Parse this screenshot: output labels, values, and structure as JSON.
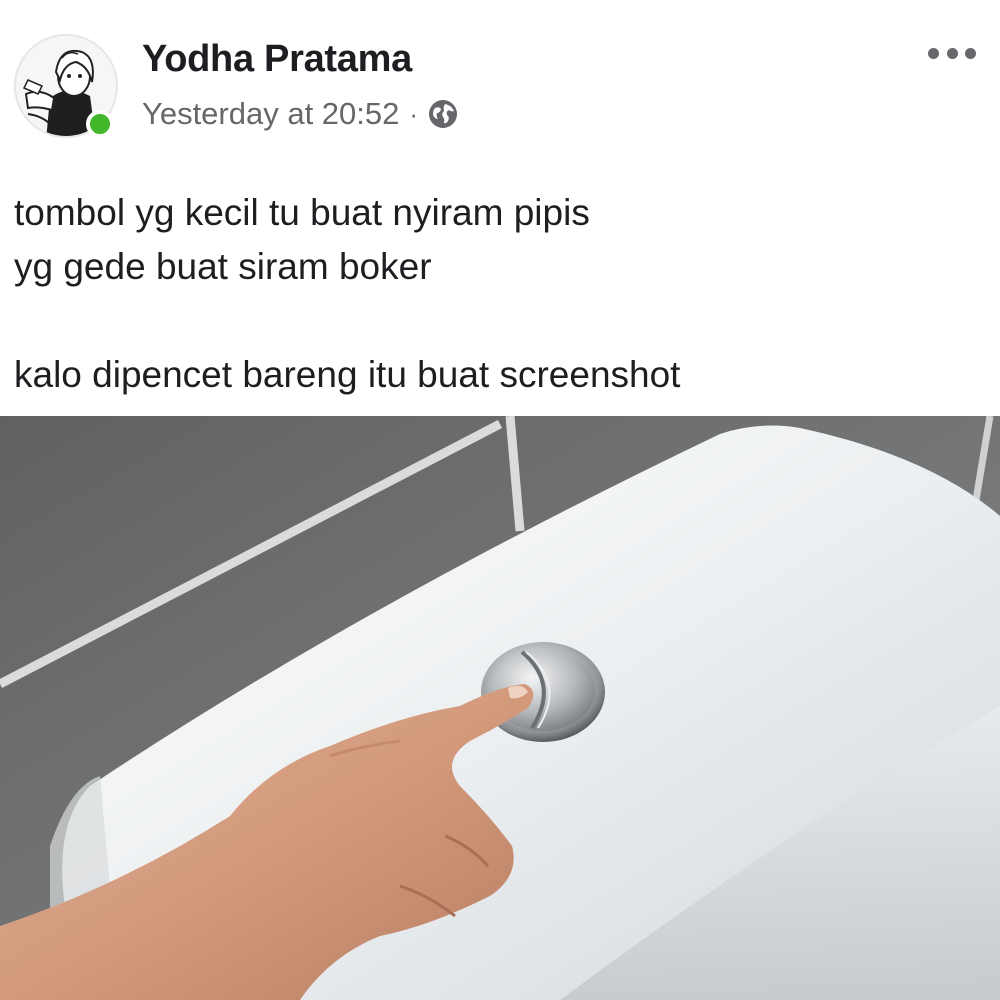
{
  "post": {
    "author": {
      "name": "Yodha Pratama",
      "avatar_icon": "user-avatar-icon",
      "online": true,
      "online_color": "#42b72a"
    },
    "timestamp": "Yesterday at 20:52",
    "separator": "·",
    "privacy_icon": "globe-icon",
    "more_icon": "more-options-icon",
    "text_lines": [
      "tombol yg kecil tu buat nyiram pipis",
      "yg gede buat siram boker",
      "",
      "kalo dipencet bareng itu buat screenshot"
    ],
    "photo_icon": "toilet-flush-photo"
  }
}
